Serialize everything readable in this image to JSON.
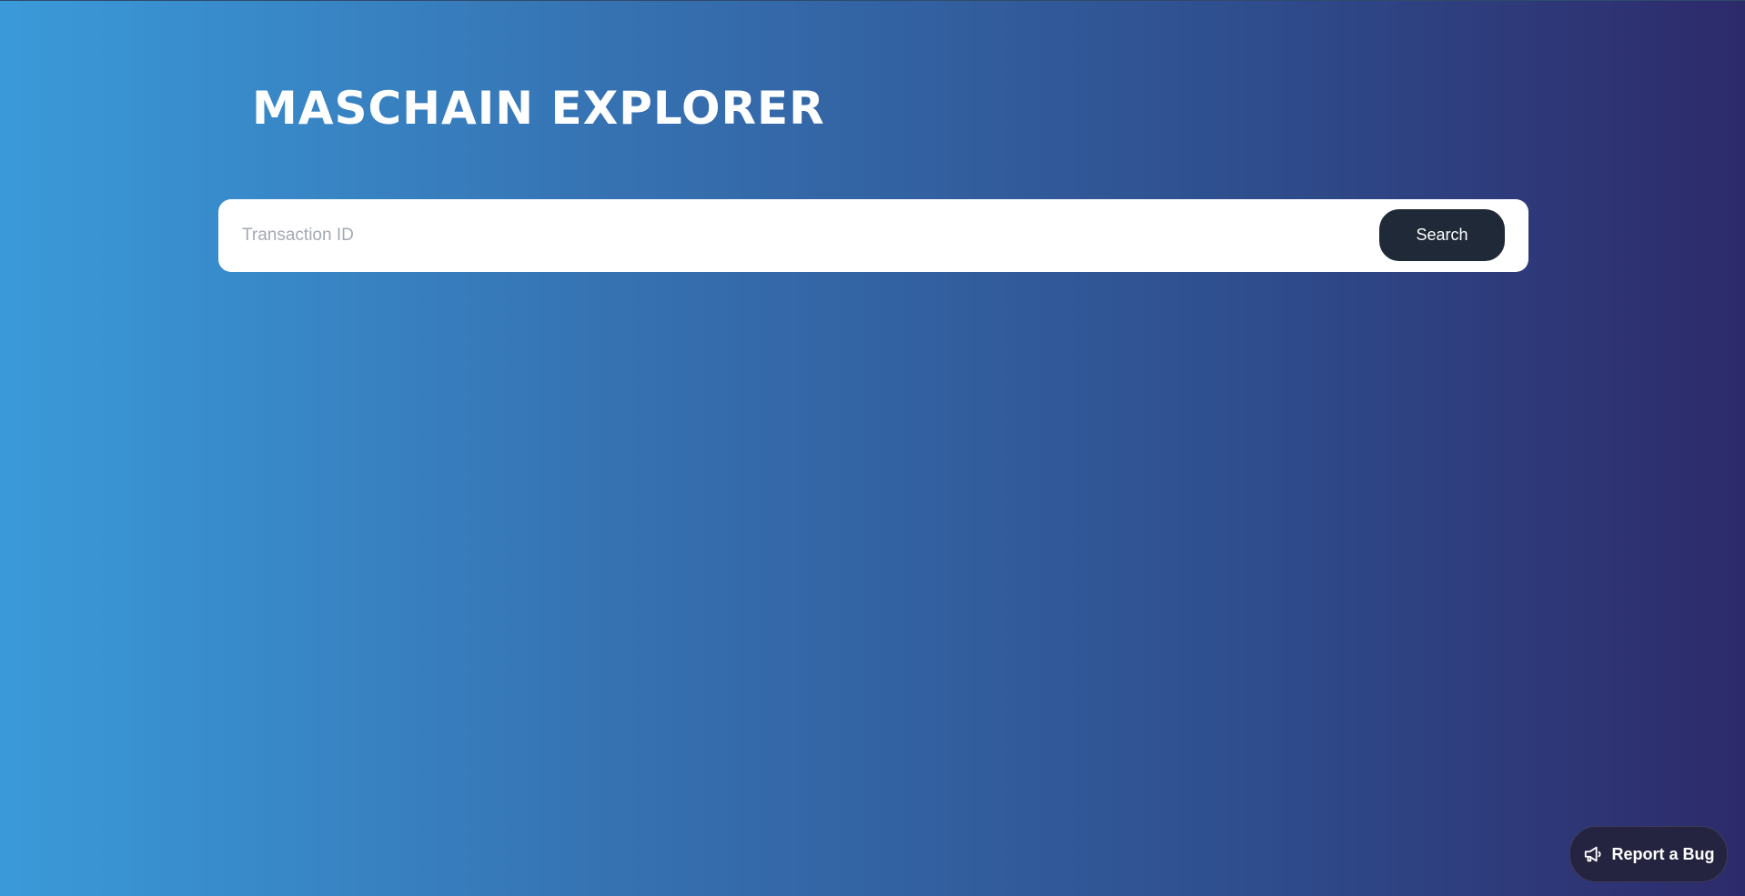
{
  "header": {
    "title": "MASCHAIN EXPLORER"
  },
  "search": {
    "placeholder": "Transaction ID",
    "value": "",
    "button_label": "Search"
  },
  "report_bug": {
    "label": "Report a Bug",
    "icon": "megaphone-icon"
  },
  "colors": {
    "gradient_start": "#3a9ad9",
    "gradient_end": "#2d2a6a",
    "button_bg": "#1f2937",
    "report_bg": "#242340"
  }
}
